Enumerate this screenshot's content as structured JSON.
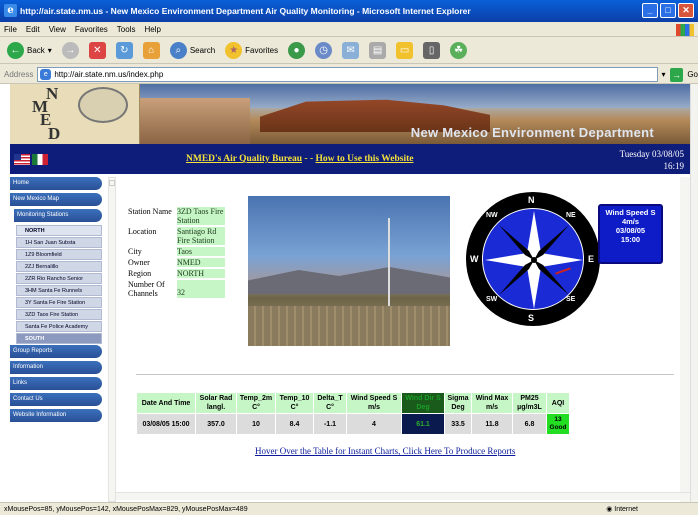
{
  "window": {
    "title": "http://air.state.nm.us - New Mexico Environment Department Air Quality Monitoring - Microsoft Internet Explorer",
    "min": "_",
    "max": "□",
    "close": "✕"
  },
  "menu": [
    "File",
    "Edit",
    "View",
    "Favorites",
    "Tools",
    "Help"
  ],
  "toolbar": {
    "back": "Back",
    "search": "Search",
    "favorites": "Favorites"
  },
  "address": {
    "label": "Address",
    "url": "http://air.state.nm.us/index.php",
    "go": "Go"
  },
  "banner": {
    "logo_letters": [
      "N",
      "M",
      "E",
      "D"
    ],
    "org_name": "New Mexico Environment Department"
  },
  "header": {
    "link1": "NMED's Air Quality Bureau",
    "sep": " - - ",
    "link2": "How to Use this Website",
    "day_date": "Tuesday 03/08/05",
    "time": "16:19"
  },
  "nav": {
    "home": "Home",
    "map": "New Mexico Map",
    "stations": "Monitoring Stations",
    "north": "NORTH",
    "north_items": [
      "1H San Juan Substa",
      "1Z9 Bloomfield",
      "2ZJ Bernalillo",
      "2ZR Rio Rancho Senior",
      "3HM Santa Fe Runnels",
      "3Y Santa Fe Fire Station",
      "3ZD Taos Fire Station",
      "Santa Fe Police Academy"
    ],
    "south": "SOUTH",
    "group": "Group Reports",
    "info": "Information",
    "links": "Links",
    "contact": "Contact Us",
    "website": "Website Information"
  },
  "station": {
    "rows": [
      {
        "label": "Station Name",
        "value": "3ZD Taos Fire Station"
      },
      {
        "label": "Location",
        "value": "Santiago Rd Fire Station"
      },
      {
        "label": "City",
        "value": "Taos"
      },
      {
        "label": "Owner",
        "value": "NMED"
      },
      {
        "label": "Region",
        "value": "NORTH"
      },
      {
        "label": "Number Of Channels",
        "value": "32"
      }
    ]
  },
  "compass": {
    "n": "N",
    "s": "S",
    "e": "E",
    "w": "W",
    "ne": "NE",
    "nw": "NW",
    "se": "SE",
    "sw": "SW"
  },
  "wind_box": {
    "title": "Wind Speed S",
    "value": "4m/s",
    "date": "03/08/05",
    "time": "15:00"
  },
  "table": {
    "headers": [
      "Date And Time",
      "Solar Rad langl.",
      "Temp_2m C°",
      "Temp_10 C°",
      "Delta_T C°",
      "Wind Speed S m/s",
      "Wind Dir S Deg",
      "Sigma Deg",
      "Wind Max m/s",
      "PM25 µg/m3L",
      "AQI"
    ],
    "values": [
      "03/08/05 15:00",
      "357.0",
      "10",
      "8.4",
      "-1.1",
      "4",
      "61.1",
      "33.5",
      "11.8",
      "6.8",
      "13 Good"
    ]
  },
  "hover_text": "Hover Over the Table for Instant Charts, Click Here To Produce Reports",
  "status": {
    "left": "xMousePos=85, yMousePos=142, xMousePosMax=829, yMousePosMax=489",
    "zone": "Internet"
  }
}
